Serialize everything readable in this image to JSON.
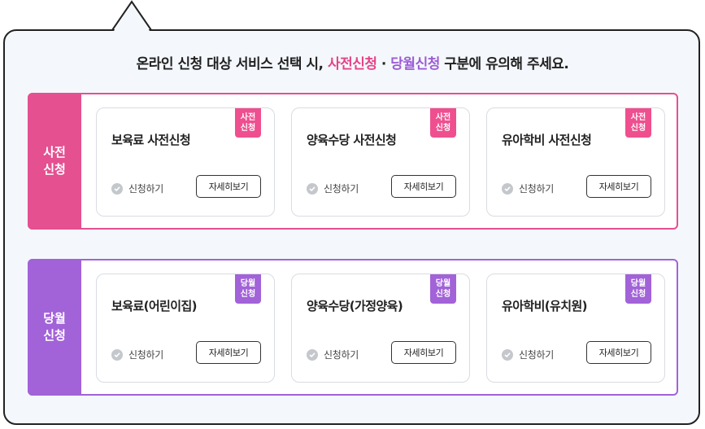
{
  "notice": {
    "prefix": "온라인 신청 대상 서비스 선택 시, ",
    "highlight_pre": "사전신청",
    "separator": " · ",
    "highlight_same": "당월신청",
    "suffix": " 구분에 유의해 주세요."
  },
  "sections": [
    {
      "label": "사전\n신청",
      "cards": [
        {
          "badge": "사전\n신청",
          "title": "보육료 사전신청",
          "apply": "신청하기",
          "detail": "자세히보기"
        },
        {
          "badge": "사전\n신청",
          "title": "양육수당 사전신청",
          "apply": "신청하기",
          "detail": "자세히보기"
        },
        {
          "badge": "사전\n신청",
          "title": "유아학비 사전신청",
          "apply": "신청하기",
          "detail": "자세히보기"
        }
      ]
    },
    {
      "label": "당월\n신청",
      "cards": [
        {
          "badge": "당월\n신청",
          "title": "보육료(어린이집)",
          "apply": "신청하기",
          "detail": "자세히보기"
        },
        {
          "badge": "당월\n신청",
          "title": "양육수당(가정양육)",
          "apply": "신청하기",
          "detail": "자세히보기"
        },
        {
          "badge": "당월\n신청",
          "title": "유아학비(유치원)",
          "apply": "신청하기",
          "detail": "자세히보기"
        }
      ]
    }
  ],
  "colors": {
    "pre": "#e45090",
    "same": "#a262d8"
  },
  "icons": {
    "apply": "check-circle-icon"
  }
}
